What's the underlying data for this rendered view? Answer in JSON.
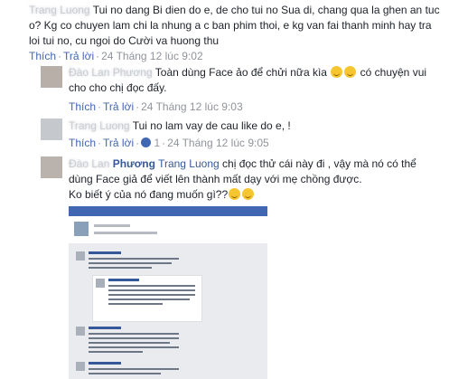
{
  "comments": [
    {
      "author": "Trang Luong",
      "text": "Tui no dang Bi dien do e, de cho tui no Sua di, chang qua la ghen an tuc o? Kg co chuyen lam chi la nhung a c ban phim thoi, e kg van fai thanh minh hay tra loi tui no, cu ngoi do Cười va huong thu",
      "actions": {
        "like": "Thích",
        "reply": "Trả lời"
      },
      "time": "24 Tháng 12 lúc 9:02"
    },
    {
      "author": "Đào Lan Phương",
      "text": "Toàn dùng Face ảo để chửi nữa kìa",
      "text2": "có chuyện vui cho cho chị đọc đấy.",
      "actions": {
        "like": "Thích",
        "reply": "Trả lời"
      },
      "time": "24 Tháng 12 lúc 9:03"
    },
    {
      "author": "Trang Luong",
      "text": "Tui no lam vay de cau like do e, !",
      "actions": {
        "like": "Thích",
        "reply": "Trả lời"
      },
      "likes": "1",
      "time": "24 Tháng 12 lúc 9:05"
    },
    {
      "author_prefix": "Phương",
      "author": "Trang Luong",
      "line1": "chị đọc thử cái này đi , vậy mà nó có thể",
      "line2": "dùng Face giả để viết lên thành mất dạy với mẹ chồng được.",
      "line3": "Ko biết ý của nó đang muốn gì??"
    }
  ],
  "icons": [
    "smile-emoji-icon"
  ]
}
